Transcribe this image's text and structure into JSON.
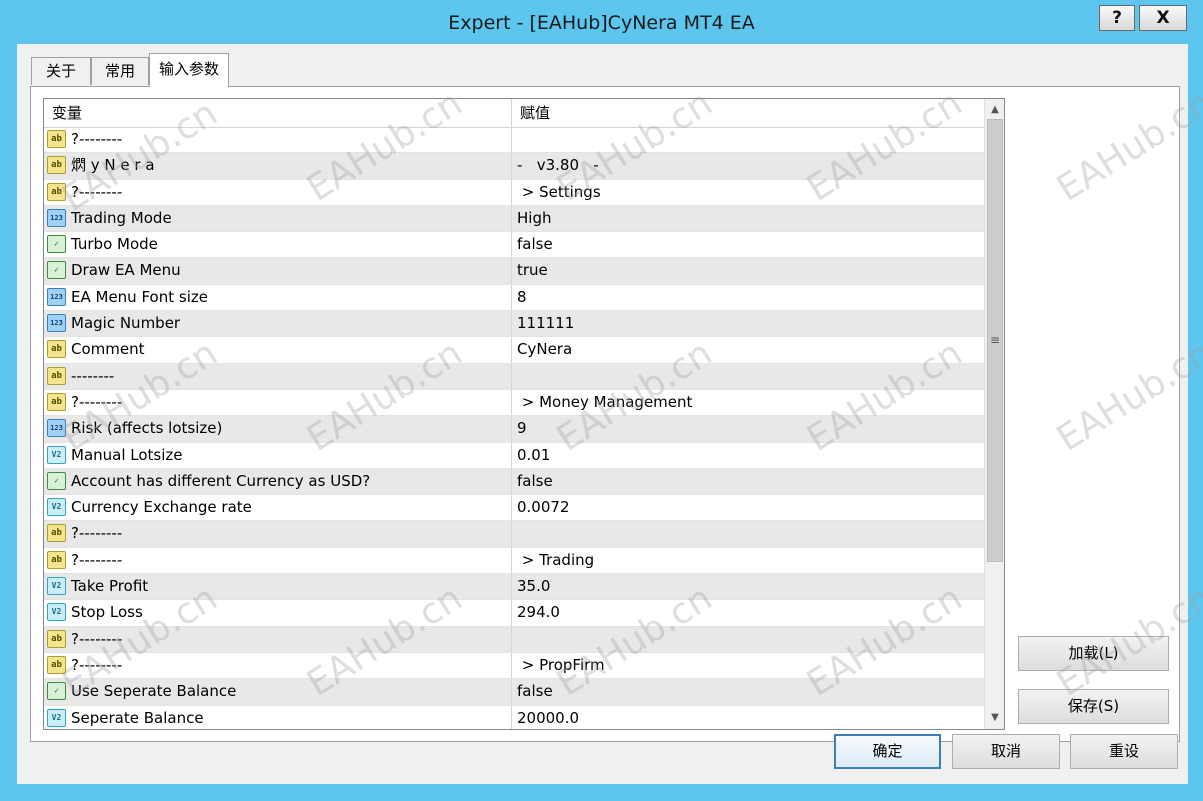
{
  "window": {
    "title": "Expert - [EAHub]CyNera MT4 EA",
    "help_label": "?",
    "close_label": "X"
  },
  "tabs": [
    {
      "label": "关于"
    },
    {
      "label": "常用"
    },
    {
      "label": "输入参数"
    }
  ],
  "grid": {
    "header": {
      "variable": "变量",
      "value": "赋值"
    },
    "rows": [
      {
        "icon": "ab",
        "name": "?--------",
        "value": ""
      },
      {
        "icon": "ab",
        "name": "熌 y N e r a",
        "value": "-   v3.80   -"
      },
      {
        "icon": "ab",
        "name": "?--------",
        "value": " > Settings"
      },
      {
        "icon": "123",
        "name": "Trading Mode",
        "value": "High"
      },
      {
        "icon": "bool",
        "name": "Turbo Mode",
        "value": "false"
      },
      {
        "icon": "bool",
        "name": "Draw EA Menu",
        "value": "true"
      },
      {
        "icon": "123",
        "name": "EA Menu Font size",
        "value": "8"
      },
      {
        "icon": "123",
        "name": "Magic Number",
        "value": "111111"
      },
      {
        "icon": "ab",
        "name": "Comment",
        "value": "CyNera"
      },
      {
        "icon": "ab",
        "name": "--------",
        "value": ""
      },
      {
        "icon": "ab",
        "name": "?--------",
        "value": " > Money Management"
      },
      {
        "icon": "123",
        "name": "Risk (affects lotsize)",
        "value": "9"
      },
      {
        "icon": "v2",
        "name": "Manual Lotsize",
        "value": "0.01"
      },
      {
        "icon": "bool",
        "name": "Account has different Currency as USD?",
        "value": "false"
      },
      {
        "icon": "v2",
        "name": "Currency Exchange rate",
        "value": "0.0072"
      },
      {
        "icon": "ab",
        "name": "?--------",
        "value": ""
      },
      {
        "icon": "ab",
        "name": "?--------",
        "value": " > Trading"
      },
      {
        "icon": "v2",
        "name": "Take Profit",
        "value": "35.0"
      },
      {
        "icon": "v2",
        "name": "Stop Loss",
        "value": "294.0"
      },
      {
        "icon": "ab",
        "name": "?--------",
        "value": ""
      },
      {
        "icon": "ab",
        "name": "?--------",
        "value": " > PropFirm"
      },
      {
        "icon": "bool",
        "name": "Use Seperate Balance",
        "value": "false"
      },
      {
        "icon": "v2",
        "name": "Seperate Balance",
        "value": "20000.0"
      }
    ]
  },
  "buttons": {
    "load": "加载(L)",
    "save": "保存(S)",
    "ok": "确定",
    "cancel": "取消",
    "reset": "重设"
  },
  "watermark": "EAHub.cn",
  "colors": {
    "titlebar": "#5cc6ee",
    "row_alt": "#e8e8e8"
  }
}
